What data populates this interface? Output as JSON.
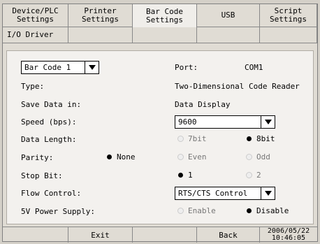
{
  "tabs": [
    {
      "label": "Device/PLC\nSettings"
    },
    {
      "label": "Printer\nSettings"
    },
    {
      "label": "Bar Code\nSettings"
    },
    {
      "label": "USB"
    },
    {
      "label": "Script\nSettings"
    }
  ],
  "subtabs": [
    {
      "label": "I/O Driver"
    }
  ],
  "form": {
    "barcode_select": "Bar Code 1",
    "port_label": "Port:",
    "port_value": "COM1",
    "type_label": "Type:",
    "type_value": "Two-Dimensional Code Reader",
    "save_label": "Save Data in:",
    "save_value": "Data Display",
    "speed_label": "Speed (bps):",
    "speed_value": "9600",
    "length_label": "Data Length:",
    "length_7": "7bit",
    "length_8": "8bit",
    "parity_label": "Parity:",
    "parity_none": "None",
    "parity_even": "Even",
    "parity_odd": "Odd",
    "stop_label": "Stop Bit:",
    "stop_1": "1",
    "stop_2": "2",
    "flow_label": "Flow Control:",
    "flow_value": "RTS/CTS Control",
    "power_label": "5V Power Supply:",
    "power_enable": "Enable",
    "power_disable": "Disable"
  },
  "footer": {
    "exit": "Exit",
    "back": "Back",
    "clock": "2006/05/22\n10:46:05"
  }
}
